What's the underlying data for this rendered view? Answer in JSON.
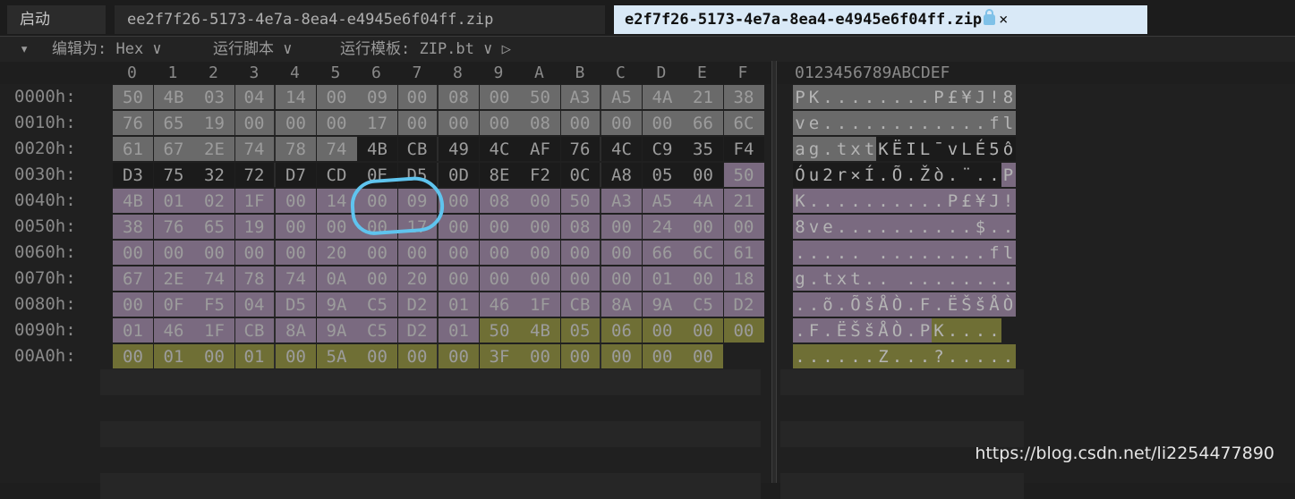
{
  "tabs": {
    "start": "启动",
    "file1": "ee2f7f26-5173-4e7a-8ea4-e4945e6f04ff.zip",
    "file2": "e2f7f26-5173-4e7a-8ea4-e4945e6f04ff.zip",
    "close": "×"
  },
  "toolbar": {
    "collapse": "▾",
    "edit_as": "编辑为: Hex ∨",
    "run_script": "运行脚本 ∨",
    "run_template": "运行模板: ZIP.bt ∨ ▷"
  },
  "columns_hex": [
    "0",
    "1",
    "2",
    "3",
    "4",
    "5",
    "6",
    "7",
    "8",
    "9",
    "A",
    "B",
    "C",
    "D",
    "E",
    "F"
  ],
  "columns_ascii": "0123456789ABCDEF",
  "rows": [
    {
      "offset": "0000h:",
      "bytes": [
        "50",
        "4B",
        "03",
        "04",
        "14",
        "00",
        "09",
        "00",
        "08",
        "00",
        "50",
        "A3",
        "A5",
        "4A",
        "21",
        "38"
      ],
      "ascii": "PK........P£¥J!8"
    },
    {
      "offset": "0010h:",
      "bytes": [
        "76",
        "65",
        "19",
        "00",
        "00",
        "00",
        "17",
        "00",
        "00",
        "00",
        "08",
        "00",
        "00",
        "00",
        "66",
        "6C"
      ],
      "ascii": "ve............fl"
    },
    {
      "offset": "0020h:",
      "bytes": [
        "61",
        "67",
        "2E",
        "74",
        "78",
        "74",
        "4B",
        "CB",
        "49",
        "4C",
        "AF",
        "76",
        "4C",
        "C9",
        "35",
        "F4"
      ],
      "ascii": "ag.txtKËIL¯vLÉ5ô"
    },
    {
      "offset": "0030h:",
      "bytes": [
        "D3",
        "75",
        "32",
        "72",
        "D7",
        "CD",
        "0E",
        "D5",
        "0D",
        "8E",
        "F2",
        "0C",
        "A8",
        "05",
        "00",
        "50"
      ],
      "ascii": "Óu2r×Í.Õ.Žò.¨..P"
    },
    {
      "offset": "0040h:",
      "bytes": [
        "4B",
        "01",
        "02",
        "1F",
        "00",
        "14",
        "00",
        "09",
        "00",
        "08",
        "00",
        "50",
        "A3",
        "A5",
        "4A",
        "21"
      ],
      "ascii": "K..........P£¥J!"
    },
    {
      "offset": "0050h:",
      "bytes": [
        "38",
        "76",
        "65",
        "19",
        "00",
        "00",
        "00",
        "17",
        "00",
        "00",
        "00",
        "08",
        "00",
        "24",
        "00",
        "00"
      ],
      "ascii": "8ve..........$.."
    },
    {
      "offset": "0060h:",
      "bytes": [
        "00",
        "00",
        "00",
        "00",
        "00",
        "20",
        "00",
        "00",
        "00",
        "00",
        "00",
        "00",
        "00",
        "66",
        "6C",
        "61"
      ],
      "ascii": "..... ........fla"
    },
    {
      "offset": "0070h:",
      "bytes": [
        "67",
        "2E",
        "74",
        "78",
        "74",
        "0A",
        "00",
        "20",
        "00",
        "00",
        "00",
        "00",
        "00",
        "01",
        "00",
        "18"
      ],
      "ascii": "g.txt.. ........"
    },
    {
      "offset": "0080h:",
      "bytes": [
        "00",
        "0F",
        "F5",
        "04",
        "D5",
        "9A",
        "C5",
        "D2",
        "01",
        "46",
        "1F",
        "CB",
        "8A",
        "9A",
        "C5",
        "D2"
      ],
      "ascii": "..õ.ÕšÅÒ.F.ËŠšÅÒ"
    },
    {
      "offset": "0090h:",
      "bytes": [
        "01",
        "46",
        "1F",
        "CB",
        "8A",
        "9A",
        "C5",
        "D2",
        "01",
        "50",
        "4B",
        "05",
        "06",
        "00",
        "00",
        "00"
      ],
      "ascii": ".F.ËŠšÅÒ.PK...."
    },
    {
      "offset": "00A0h:",
      "bytes": [
        "00",
        "01",
        "00",
        "01",
        "00",
        "5A",
        "00",
        "00",
        "00",
        "3F",
        "00",
        "00",
        "00",
        "00",
        "00"
      ],
      "ascii": "......Z...?....."
    }
  ],
  "watermark": "https://blog.csdn.net/li2254477890"
}
